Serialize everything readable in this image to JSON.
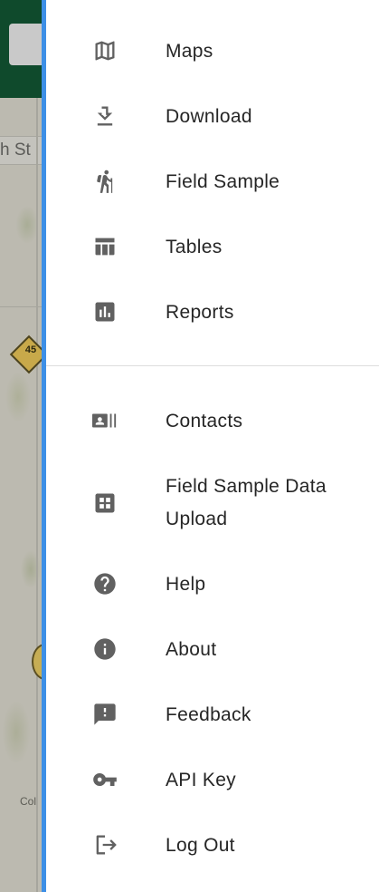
{
  "background_map": {
    "street_label": "h St",
    "marker_label": "45",
    "place_label": "Col"
  },
  "drawer": {
    "primary_items": [
      {
        "label": "Maps",
        "icon": "map-icon"
      },
      {
        "label": "Download",
        "icon": "download-icon"
      },
      {
        "label": "Field Sample",
        "icon": "hiker-icon"
      },
      {
        "label": "Tables",
        "icon": "table-icon"
      },
      {
        "label": "Reports",
        "icon": "bar-chart-icon"
      }
    ],
    "secondary_items": [
      {
        "label": "Contacts",
        "icon": "contacts-icon"
      },
      {
        "label_line1": "Field Sample Data",
        "label_line2": "Upload",
        "icon": "grid-upload-icon"
      },
      {
        "label": "Help",
        "icon": "help-icon"
      },
      {
        "label": "About",
        "icon": "info-icon"
      },
      {
        "label": "Feedback",
        "icon": "feedback-icon"
      },
      {
        "label": "API Key",
        "icon": "key-icon"
      },
      {
        "label": "Log Out",
        "icon": "logout-icon"
      }
    ]
  },
  "colors": {
    "drawer_edge": "#3d8fe6",
    "header_green": "#0f4a2c",
    "icon_gray": "#616161",
    "label_text": "#262626"
  }
}
